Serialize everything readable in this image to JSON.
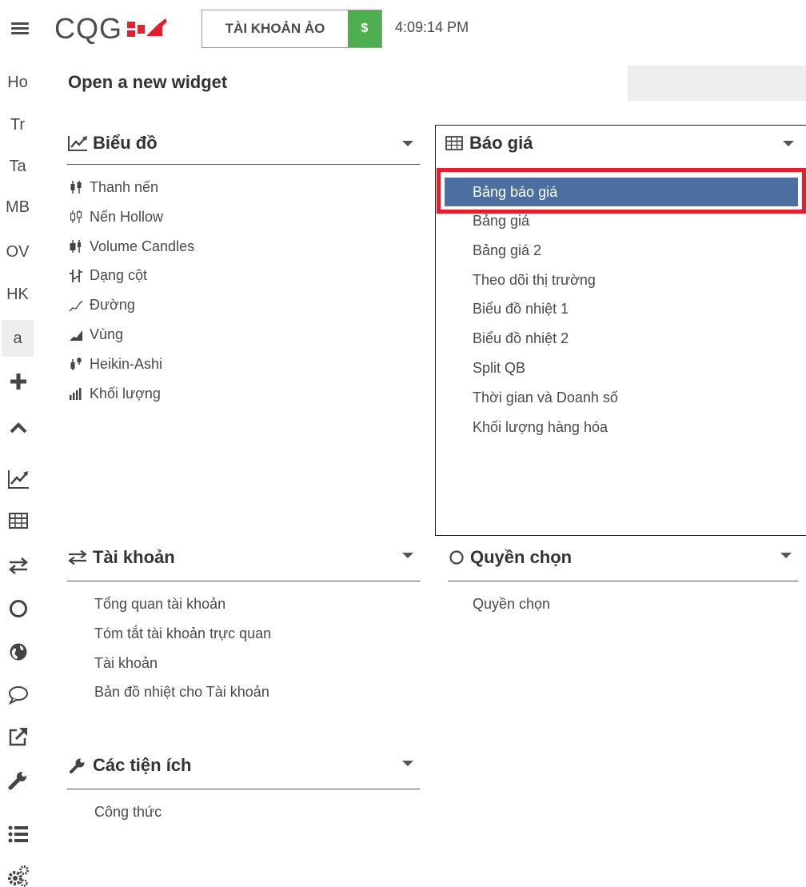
{
  "app": {
    "logo_text": "CQG",
    "account_label": "TÀI KHOẢN ẢO",
    "account_currency": "$",
    "clock": "4:09:14 PM",
    "accent_green": "#4fae4f",
    "selected_blue": "#4a6fa0",
    "highlight_red": "#e0202c"
  },
  "rail": {
    "tabs": [
      "Ho",
      "Tr",
      "Ta",
      "MB",
      "OV",
      "HK",
      "a"
    ],
    "active_tab": "a",
    "icons": [
      "plus-icon",
      "chevron-up-icon",
      "chart-line-icon",
      "table-icon",
      "transfer-arrows-icon",
      "circle-icon",
      "globe-icon",
      "chat-bubble-icon",
      "external-link-icon",
      "wrench-icon",
      "list-icon",
      "gears-icon"
    ]
  },
  "main": {
    "title": "Open a new widget",
    "search_placeholder": ""
  },
  "sections": {
    "charts": {
      "title": "Biểu đồ",
      "icon": "chart-line-icon",
      "items": [
        "Thanh nến",
        "Nến Hollow",
        "Volume Candles",
        "Dạng cột",
        "Đường",
        "Vùng",
        "Heikin-Ashi",
        "Khối lượng"
      ]
    },
    "quotes": {
      "title": "Báo giá",
      "icon": "table-icon",
      "items": [
        "Bảng báo giá",
        "Bảng giá",
        "Bảng giá 2",
        "Theo dõi thị trường",
        "Biểu đồ nhiệt 1",
        "Biểu đồ nhiệt 2",
        "Split QB",
        "Thời gian và Doanh số",
        "Khối lượng hàng hóa"
      ],
      "selected": "Bảng báo giá"
    },
    "account": {
      "title": "Tài khoản",
      "icon": "transfer-arrows-icon",
      "items": [
        "Tổng quan tài khoản",
        "Tóm tắt tài khoản trực quan",
        "Tài khoản",
        "Bản đồ nhiệt cho Tài khoản"
      ]
    },
    "options": {
      "title": "Quyền chọn",
      "icon": "circle-icon",
      "items": [
        "Quyền chọn"
      ]
    },
    "utilities": {
      "title": "Các tiện ích",
      "icon": "wrench-icon",
      "items": [
        "Công thức"
      ]
    }
  }
}
